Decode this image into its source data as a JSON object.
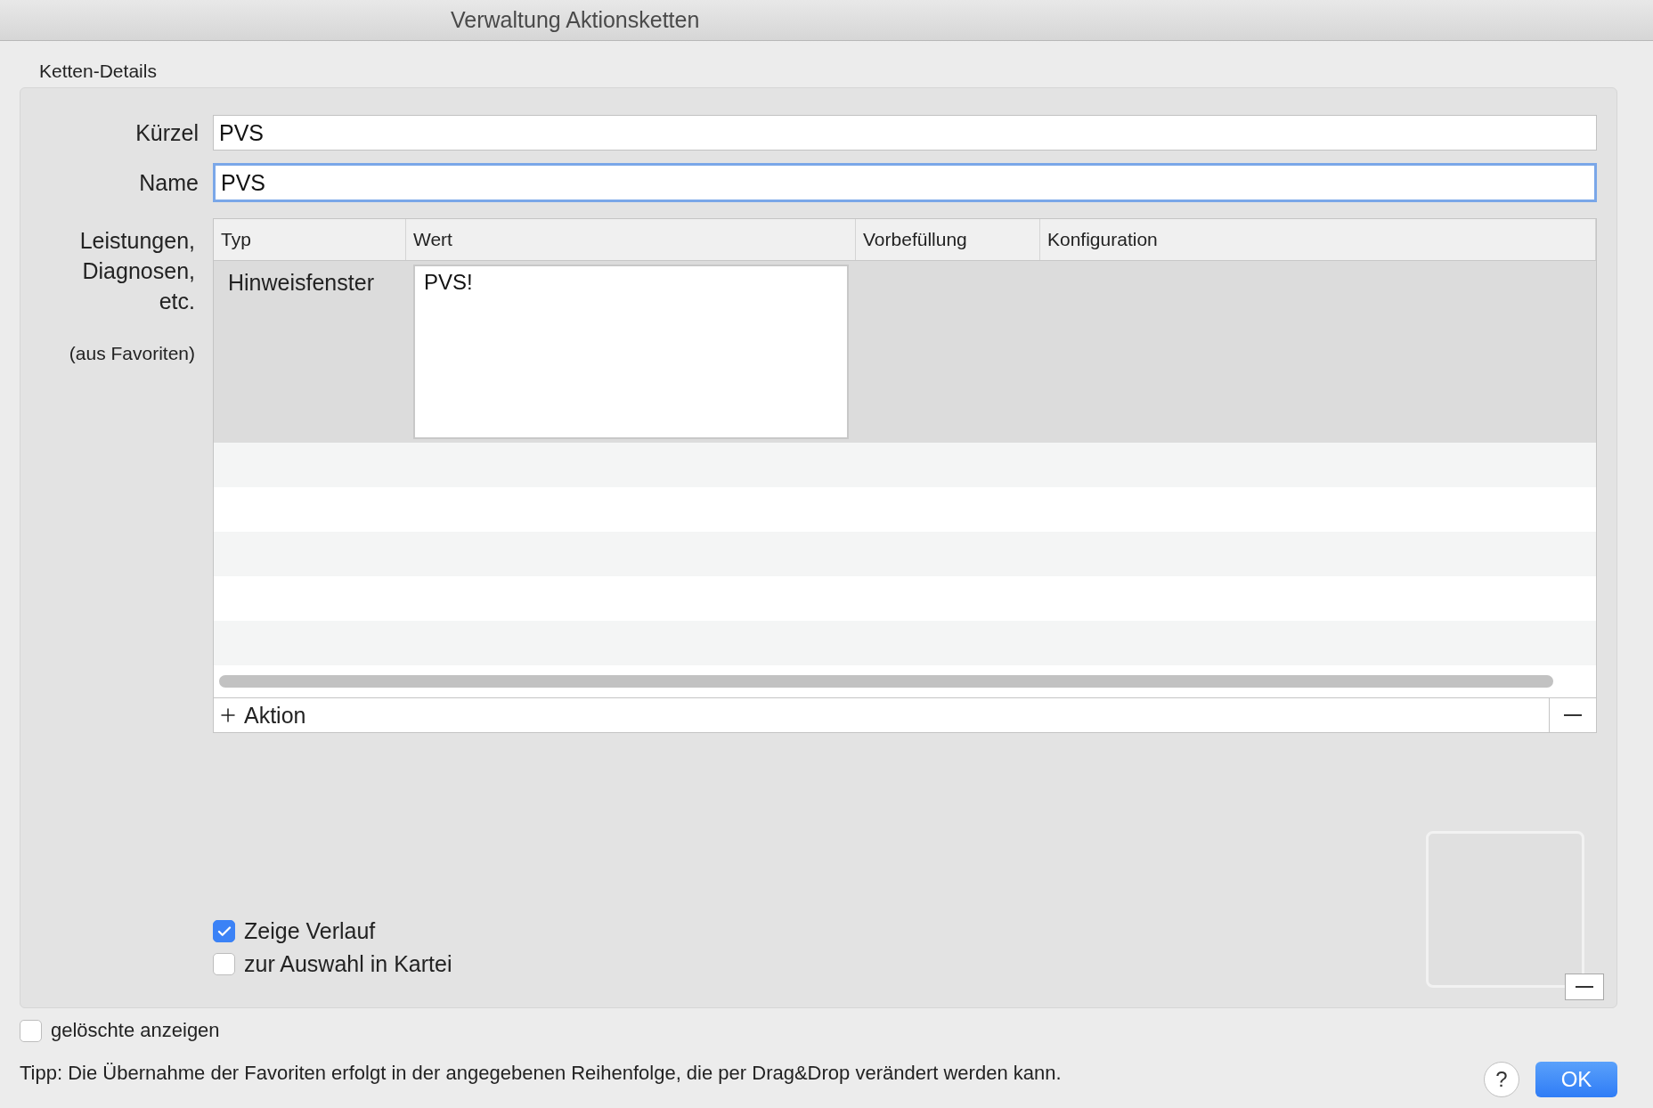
{
  "window": {
    "title": "Verwaltung Aktionsketten"
  },
  "group": {
    "title": "Ketten-Details"
  },
  "fields": [
    {
      "label": "Kürzel",
      "value": "PVS",
      "focused": false
    },
    {
      "label": "Name",
      "value": "PVS",
      "focused": true
    }
  ],
  "actions": {
    "label": "Leistungen, Diagnosen, etc.",
    "note": "(aus Favoriten)"
  },
  "table": {
    "columns": [
      "Typ",
      "Wert",
      "Vorbefüllung",
      "Konfiguration"
    ],
    "rows": [
      {
        "type": "Hinweisfenster",
        "value": "PVS!",
        "selected": true
      }
    ],
    "add_label": "Aktion"
  },
  "checkboxes": [
    {
      "label": "Zeige Verlauf",
      "checked": true
    },
    {
      "label": "zur Auswahl in Kartei",
      "checked": false
    }
  ],
  "show_deleted": {
    "label": "gelöschte anzeigen",
    "checked": false
  },
  "tip": "Tipp: Die Übernahme der Favoriten erfolgt in der angegebenen Reihenfolge, die per Drag&Drop verändert werden kann.",
  "buttons": {
    "help": "?",
    "ok": "OK"
  }
}
